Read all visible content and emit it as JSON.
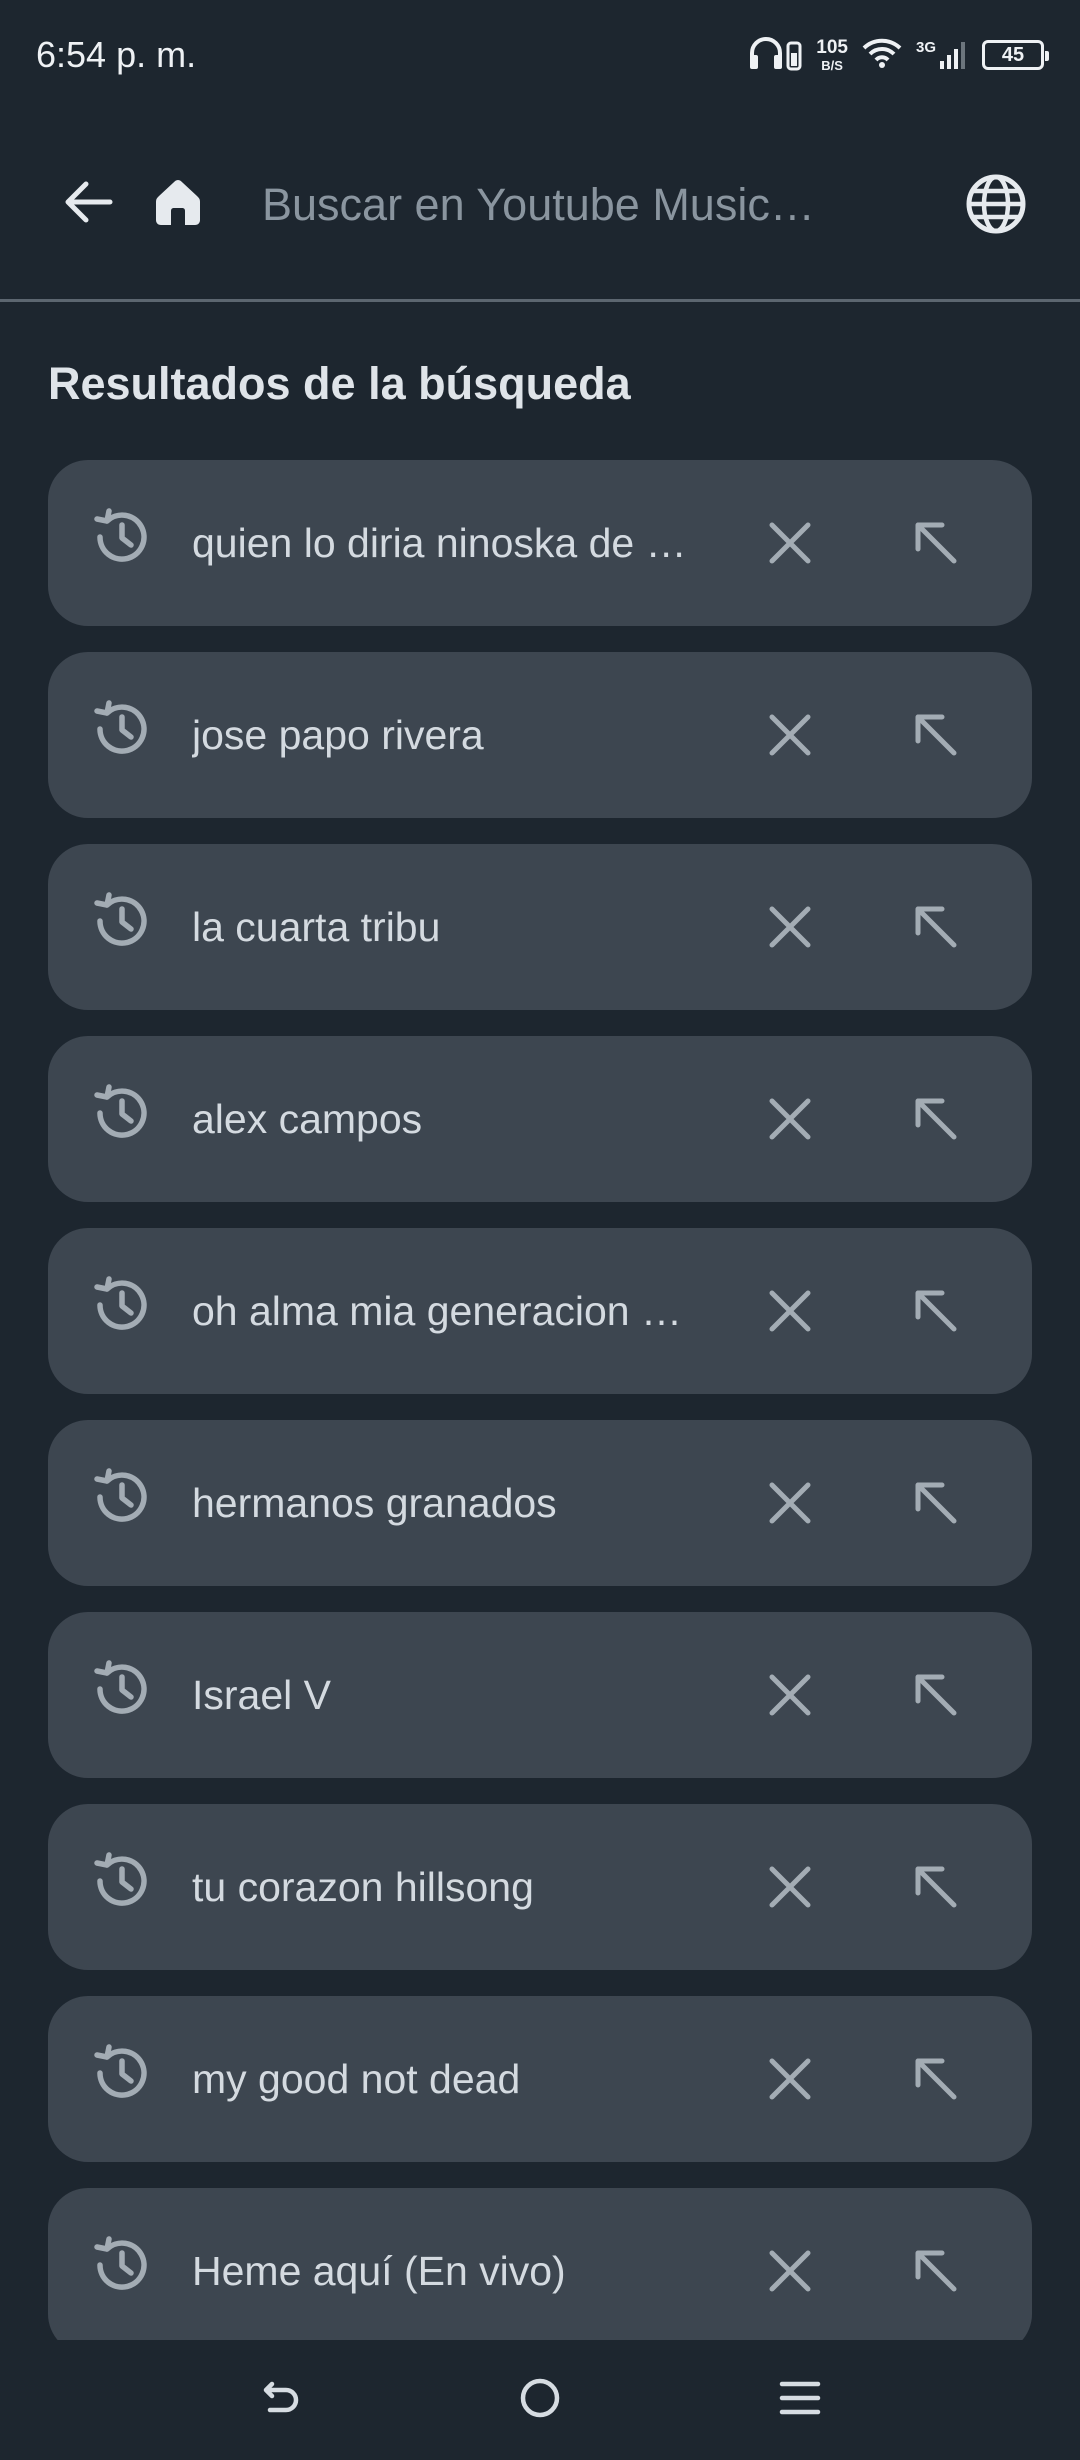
{
  "status_bar": {
    "time": "6:54 p. m.",
    "net_speed_value": "105",
    "net_speed_unit": "B/S",
    "network_type": "3G",
    "battery": "45"
  },
  "top_bar": {
    "search_placeholder": "Buscar en Youtube Music…"
  },
  "section_title": "Resultados de la búsqueda",
  "results": [
    {
      "label": "quien lo diria ninoska de …"
    },
    {
      "label": "jose papo rivera"
    },
    {
      "label": "la cuarta tribu"
    },
    {
      "label": "alex campos"
    },
    {
      "label": "oh alma mia generacion …"
    },
    {
      "label": "hermanos granados"
    },
    {
      "label": "Israel V"
    },
    {
      "label": "tu corazon hillsong"
    },
    {
      "label": "my good not dead"
    },
    {
      "label": "Heme aquí (En vivo)"
    }
  ],
  "icons": {
    "back": "arrow-left-icon",
    "home": "home-icon",
    "globe": "globe-icon",
    "history": "history-icon",
    "delete": "close-icon",
    "fill_query": "arrow-up-left-icon"
  },
  "colors": {
    "background": "#1d262f",
    "card": "#3d4650",
    "text": "#d4dae0",
    "icon": "#a3acb4"
  }
}
